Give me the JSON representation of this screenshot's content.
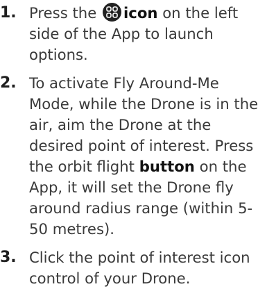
{
  "steps": [
    {
      "number": "1.",
      "before_icon": "Press the ",
      "icon_name": "grid-launch-icon",
      "bold_text": "icon",
      "after_bold": " on the left side of the App to launch options."
    },
    {
      "number": "2.",
      "before_bold": "To activate Fly Around-Me Mode, while the Drone is in the air, aim the Drone at the desired point of interest. Press the orbit flight ",
      "bold_text": "button",
      "after_bold": " on the App, it will set the Drone fly around radius range (within 5-50 metres)."
    },
    {
      "number": "3.",
      "text": "Click the point of interest icon control of your Drone."
    }
  ],
  "colors": {
    "text": "#3a3a3a",
    "numbers": "#1f1f1f",
    "icon_bg": "#222222"
  }
}
